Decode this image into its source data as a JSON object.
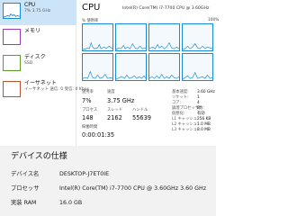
{
  "sidebar": {
    "items": [
      {
        "name": "CPU",
        "sub": "7% 3.75 GHz",
        "icon": "cpu-graph-thumbnail",
        "active": true,
        "color": "#1a8ad4",
        "level": 0.08
      },
      {
        "name": "メモリ",
        "sub": "",
        "icon": "memory-graph-thumbnail",
        "active": false,
        "color": "#9b3bb3",
        "level": 0.0
      },
      {
        "name": "ディスク",
        "sub": "SSD",
        "icon": "disk-graph-thumbnail",
        "active": false,
        "color": "#5c9e28",
        "level": 0.0
      },
      {
        "name": "イーサネット",
        "sub": "イーサネット 送信: 0 受信: 0 Kbps",
        "icon": "ethernet-graph-thumbnail",
        "active": false,
        "color": "#b3552d",
        "level": 0.0
      }
    ]
  },
  "cpu": {
    "title": "CPU",
    "model": "Intel(R) Core(TM) i7-7700 CPU @ 3.60GHz",
    "graph_label": "% 使用率",
    "graph_max": "100%",
    "graph_color": "#1a8ad4",
    "stats": {
      "usage_label": "使用率",
      "usage_value": "7%",
      "speed_label": "速度",
      "speed_value": "3.75 GHz",
      "processes_label": "プロセス",
      "processes_value": "148",
      "threads_label": "スレッド",
      "threads_value": "2162",
      "handles_label": "ハンドル",
      "handles_value": "55639",
      "uptime_label": "稼働時間",
      "uptime_value": "0:00:01:35"
    },
    "specs": [
      {
        "label": "基本速度:",
        "value": "3.60 GHz"
      },
      {
        "label": "ソケット:",
        "value": "1"
      },
      {
        "label": "コア:",
        "value": "4"
      },
      {
        "label": "論理プロセッサ数:",
        "value": "8"
      },
      {
        "label": "仮想化:",
        "value": "有効"
      },
      {
        "label": "L1 キャッシュ:",
        "value": "256 KB"
      },
      {
        "label": "L2 キャッシュ:",
        "value": "1.0 MB"
      },
      {
        "label": "L3 キャッシュ:",
        "value": "8.0 MB"
      }
    ]
  },
  "device_specs": {
    "title": "デバイスの仕様",
    "rows": [
      {
        "label": "デバイス名",
        "value": "DESKTOP-J7ET0IE"
      },
      {
        "label": "プロセッサ",
        "value": "Intel(R) Core(TM) i7-7700 CPU @ 3.60GHz   3.60 GHz"
      },
      {
        "label": "実装 RAM",
        "value": "16.0 GB"
      }
    ]
  }
}
